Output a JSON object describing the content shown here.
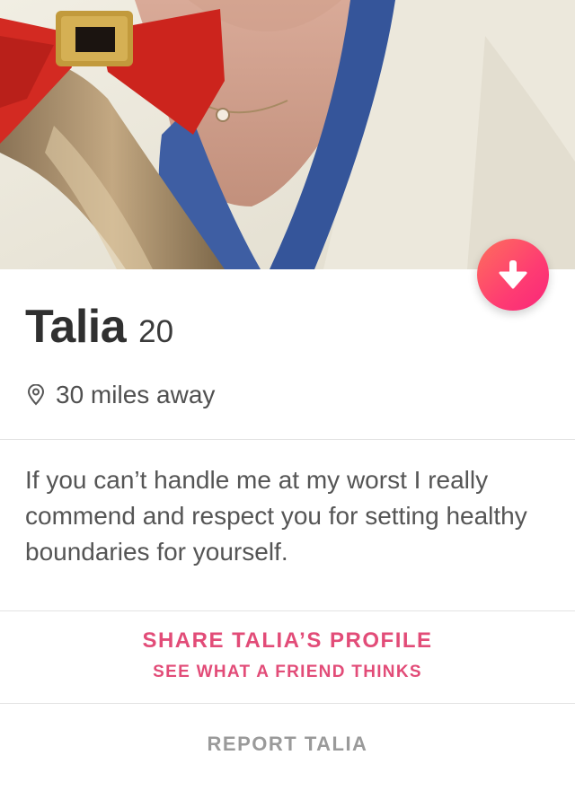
{
  "profile": {
    "name": "Talia",
    "age": "20",
    "distance": "30 miles away",
    "bio": "If you can’t handle me at my worst I really commend and respect you for setting healthy boundaries for yourself."
  },
  "actions": {
    "share_label": "SHARE TALIA’S PROFILE",
    "share_sub_label": "SEE WHAT A FRIEND THINKS",
    "report_label": "REPORT TALIA"
  },
  "icons": {
    "collapse": "arrow-down-icon",
    "location": "location-pin-icon"
  },
  "colors": {
    "accent": "#fe3c72",
    "share_text": "#e24c78",
    "report_text": "#9a9a9a"
  }
}
